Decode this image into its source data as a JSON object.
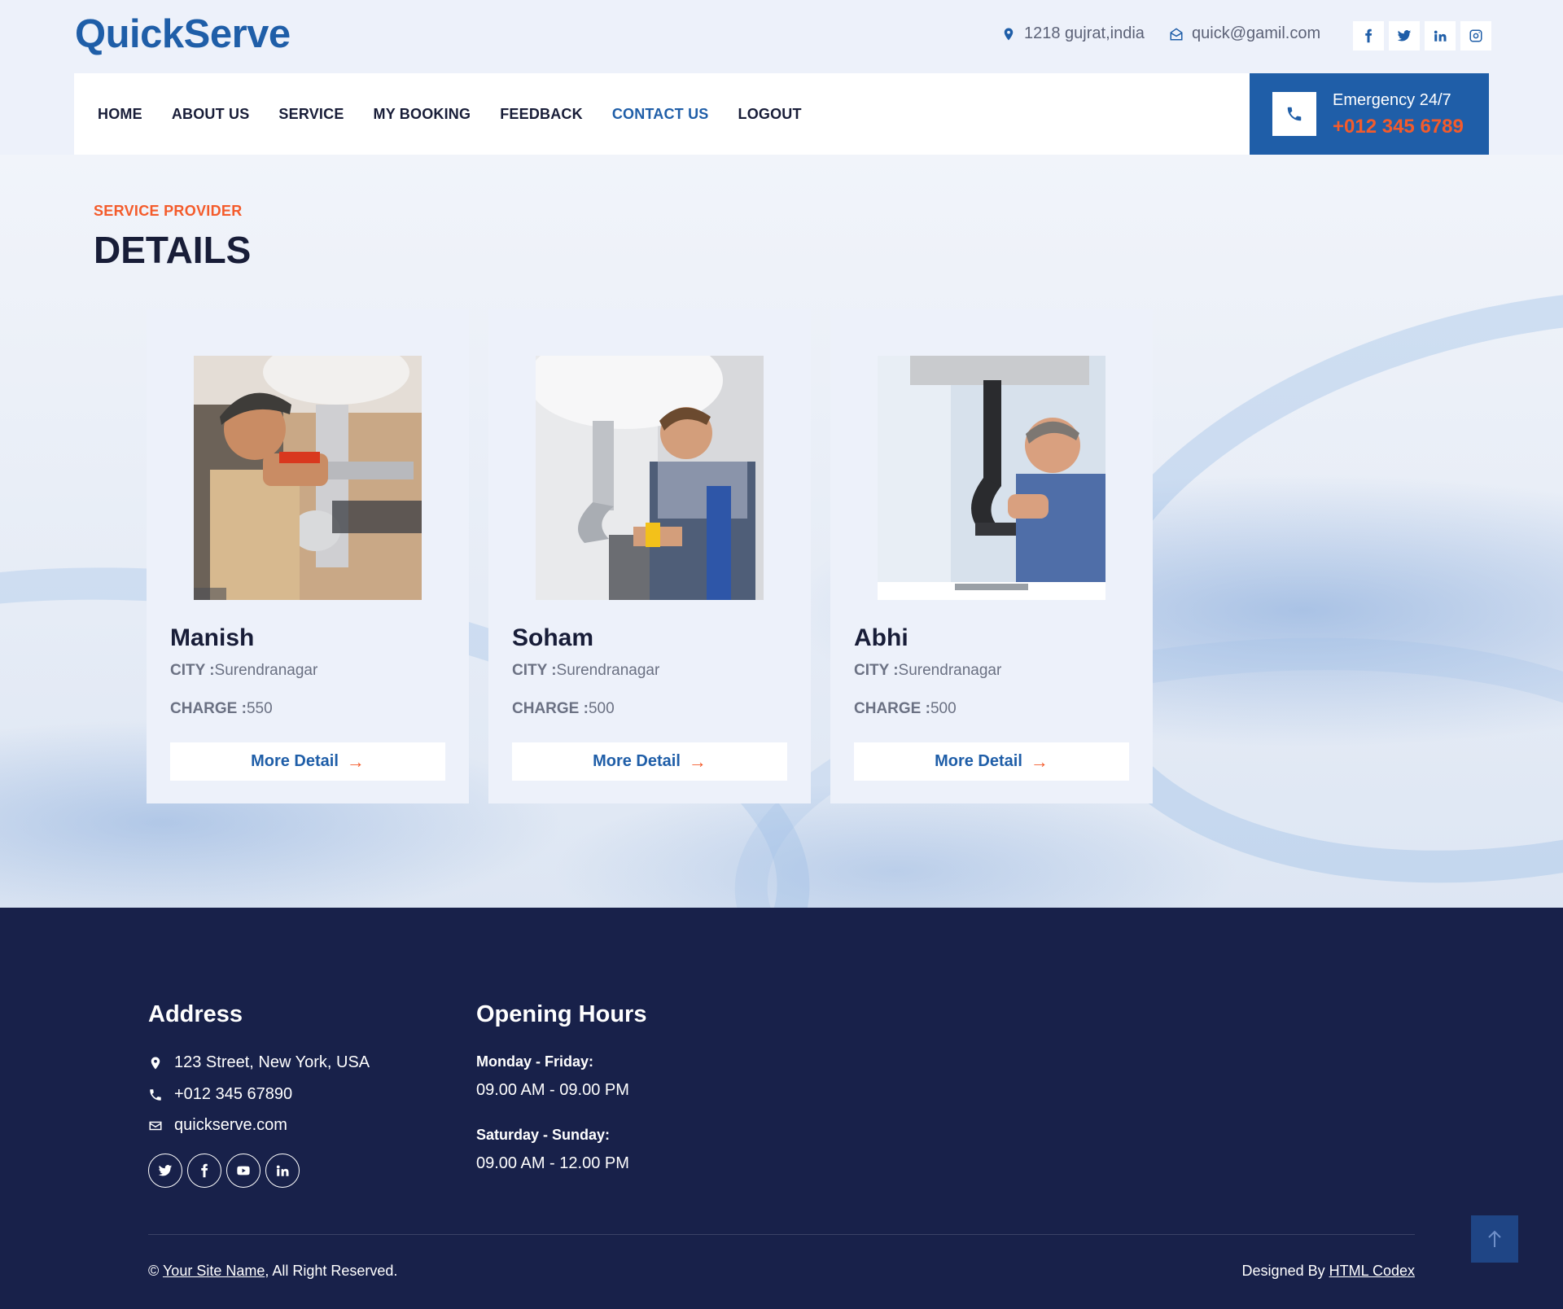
{
  "brand": {
    "name": "QuickServe"
  },
  "topbar": {
    "address": "1218 gujrat,india",
    "email": "quick@gamil.com",
    "socials": [
      {
        "icon": "facebook-icon",
        "glyph": "f"
      },
      {
        "icon": "twitter-icon",
        "glyph": ""
      },
      {
        "icon": "linkedin-icon",
        "glyph": "in"
      },
      {
        "icon": "instagram-icon",
        "glyph": ""
      }
    ]
  },
  "nav": {
    "items": [
      {
        "label": "HOME",
        "active": false
      },
      {
        "label": "ABOUT US",
        "active": false
      },
      {
        "label": "SERVICE",
        "active": false
      },
      {
        "label": "MY BOOKING",
        "active": false
      },
      {
        "label": "FEEDBACK",
        "active": false
      },
      {
        "label": "CONTACT US",
        "active": true
      },
      {
        "label": "LOGOUT",
        "active": false
      }
    ],
    "emergency": {
      "label": "Emergency 24/7",
      "phone": "+012 345 6789"
    }
  },
  "section": {
    "subtitle": "SERVICE PROVIDER",
    "title": "DETAILS"
  },
  "providers": [
    {
      "name": "Manish",
      "city_label": "CITY :",
      "city": "Surendranagar",
      "charge_label": "CHARGE :",
      "charge": "550",
      "button": "More Detail"
    },
    {
      "name": "Soham",
      "city_label": "CITY :",
      "city": "Surendranagar",
      "charge_label": "CHARGE :",
      "charge": "500",
      "button": "More Detail"
    },
    {
      "name": "Abhi",
      "city_label": "CITY :",
      "city": "Surendranagar",
      "charge_label": "CHARGE :",
      "charge": "500",
      "button": "More Detail"
    }
  ],
  "footer": {
    "address_title": "Address",
    "address": "123 Street, New York, USA",
    "phone": "+012 345 67890",
    "website": "quickserve.com",
    "hours_title": "Opening Hours",
    "hours": [
      {
        "days": "Monday - Friday:",
        "time": "09.00 AM - 09.00 PM"
      },
      {
        "days": "Saturday - Sunday:",
        "time": "09.00 AM - 12.00 PM"
      }
    ],
    "copyright_prefix": "©",
    "site_name": "Your Site Name",
    "copyright_suffix": ", All Right Reserved.",
    "designed_by_prefix": "Designed By",
    "designer": "HTML Codex"
  },
  "colors": {
    "primary": "#1f5ea8",
    "accent": "#f45b2b",
    "dark": "#181d38",
    "footer_bg": "#18214a"
  }
}
